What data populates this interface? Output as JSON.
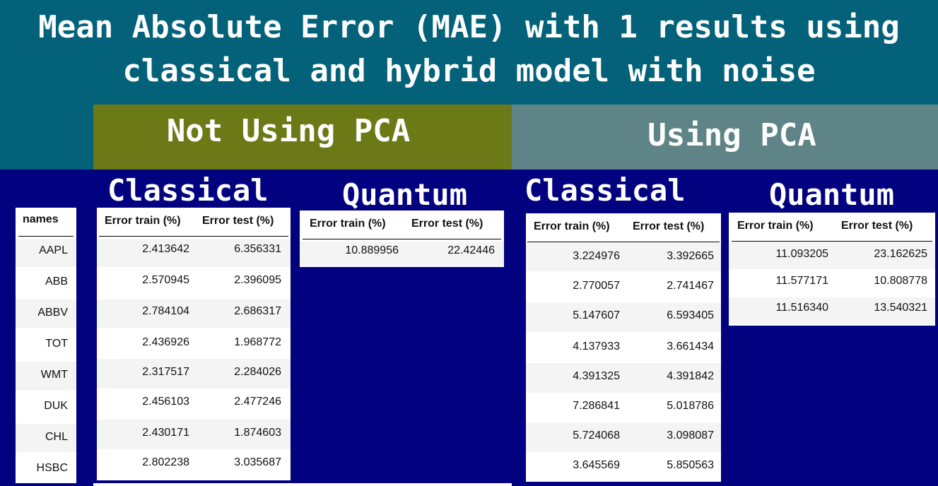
{
  "title": "Mean Absolute Error (MAE) with  1 results using\nclassical and hybrid model with noise",
  "groups": {
    "not_using_pca": "Not Using PCA",
    "using_pca": "Using PCA"
  },
  "sections": {
    "nopca_classical": "Classical",
    "nopca_quantum": "Quantum",
    "pca_classical": "Classical",
    "pca_quantum": "Quantum"
  },
  "colors": {
    "title_bg": "#03627a",
    "not_using_pca_bg": "#6b7a16",
    "using_pca_bg": "#5f8488",
    "panel_bg": "#020281"
  },
  "names_table": {
    "header": "names",
    "rows": [
      "AAPL",
      "ABB",
      "ABBV",
      "TOT",
      "WMT",
      "DUK",
      "CHL",
      "HSBC"
    ]
  },
  "nopca_classical_table": {
    "headers": [
      "Error train (%)",
      "Error test (%)"
    ],
    "rows": [
      [
        "2.413642",
        "6.356331"
      ],
      [
        "2.570945",
        "2.396095"
      ],
      [
        "2.784104",
        "2.686317"
      ],
      [
        "2.436926",
        "1.968772"
      ],
      [
        "2.317517",
        "2.284026"
      ],
      [
        "2.456103",
        "2.477246"
      ],
      [
        "2.430171",
        "1.874603"
      ],
      [
        "2.802238",
        "3.035687"
      ]
    ]
  },
  "nopca_quantum_table": {
    "headers": [
      "Error train (%)",
      "Error test (%)"
    ],
    "rows": [
      [
        "10.889956",
        "22.42446"
      ]
    ]
  },
  "pca_classical_table": {
    "headers": [
      "Error train (%)",
      "Error test (%)"
    ],
    "rows": [
      [
        "3.224976",
        "3.392665"
      ],
      [
        "2.770057",
        "2.741467"
      ],
      [
        "5.147607",
        "6.593405"
      ],
      [
        "4.137933",
        "3.661434"
      ],
      [
        "4.391325",
        "4.391842"
      ],
      [
        "7.286841",
        "5.018786"
      ],
      [
        "5.724068",
        "3.098087"
      ],
      [
        "3.645569",
        "5.850563"
      ]
    ]
  },
  "pca_quantum_table": {
    "headers": [
      "Error train (%)",
      "Error test (%)"
    ],
    "rows": [
      [
        "11.093205",
        "23.162625"
      ],
      [
        "11.577171",
        "10.808778"
      ],
      [
        "11.516340",
        "13.540321"
      ]
    ]
  }
}
